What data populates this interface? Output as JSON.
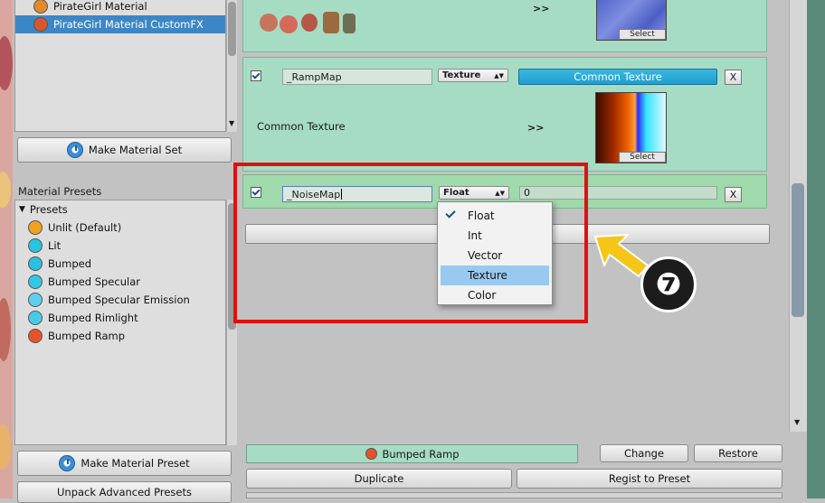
{
  "hierarchy": {
    "items": [
      {
        "label": "PirateGirl Material",
        "color": "#e08a2c"
      },
      {
        "label": "PirateGirl Material CustomFX",
        "color": "#d9562a"
      }
    ]
  },
  "buttons": {
    "make_material_set": "Make Material Set",
    "make_material_preset": "Make Material Preset",
    "unpack_advanced_presets": "Unpack Advanced Presets",
    "change": "Change",
    "restore": "Restore",
    "duplicate": "Duplicate",
    "regist_to_preset": "Regist to Preset",
    "current_preset": "Bumped Ramp"
  },
  "presets": {
    "header": "Material Presets",
    "group": "Presets",
    "items": [
      {
        "label": "Unlit (Default)",
        "color": "#f2a21f"
      },
      {
        "label": "Lit",
        "color": "#2bc3de"
      },
      {
        "label": "Bumped",
        "color": "#2bbfe0"
      },
      {
        "label": "Bumped Specular",
        "color": "#36c6e6"
      },
      {
        "label": "Bumped Specular Emission",
        "color": "#5cd0ec"
      },
      {
        "label": "Bumped Rimlight",
        "color": "#48cbe8"
      },
      {
        "label": "Bumped Ramp",
        "color": "#e8522a"
      }
    ]
  },
  "properties": {
    "top_arrow": ">>",
    "select_label": "Select",
    "ramp": {
      "name": "_RampMap",
      "type": "Texture",
      "common_button": "Common Texture",
      "common_label": "Common Texture",
      "arrow": ">>"
    },
    "noise": {
      "name": "_NoiseMap",
      "type": "Float",
      "value": "0"
    },
    "remove": "X"
  },
  "type_menu": {
    "items": [
      "Float",
      "Int",
      "Vector",
      "Texture",
      "Color"
    ],
    "checked": "Float",
    "highlighted": "Texture"
  },
  "callout": {
    "number": "❼",
    "frame_color": "#e01010",
    "arrow_color": "#f5c518"
  }
}
